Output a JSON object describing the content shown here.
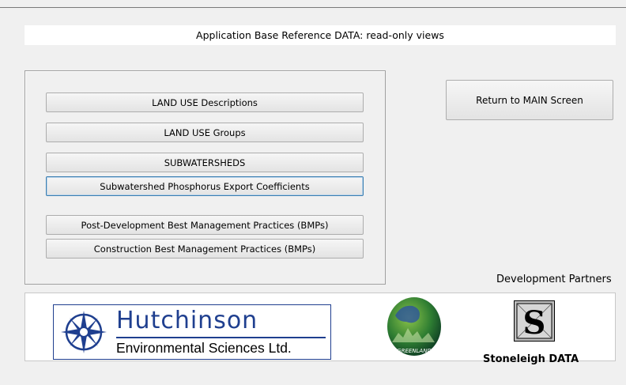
{
  "header": {
    "title": "Application Base Reference DATA: read-only views"
  },
  "menu": {
    "buttons": [
      {
        "label": "LAND USE Descriptions"
      },
      {
        "label": "LAND USE Groups"
      },
      {
        "label": "SUBWATERSHEDS"
      },
      {
        "label": "Subwatershed Phosphorus Export Coefficients"
      },
      {
        "label": "Post-Development Best Management Practices (BMPs)"
      },
      {
        "label": "Construction Best Management Practices (BMPs)"
      }
    ]
  },
  "return_button": {
    "label": "Return to MAIN Screen"
  },
  "partners": {
    "label": "Development Partners",
    "hutchinson": {
      "name": "Hutchinson",
      "subtitle": "Environmental Sciences Ltd.",
      "icon": "compass-rose-icon",
      "color": "#1f3f8f"
    },
    "greenland": {
      "text": "GREENLAND",
      "icon": "globe-icon",
      "color": "#2e7d32"
    },
    "stoneleigh": {
      "name": "Stoneleigh DATA",
      "icon": "stoneleigh-s-icon"
    }
  }
}
